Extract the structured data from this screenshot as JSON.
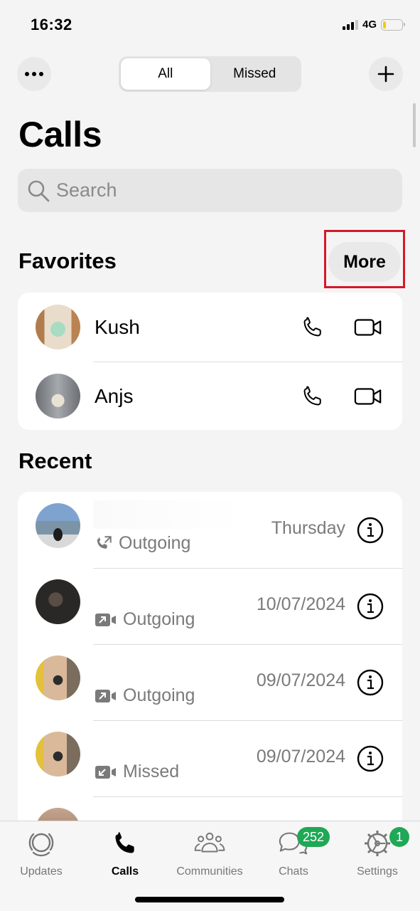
{
  "status_bar": {
    "time": "16:32",
    "network": "4G",
    "battery_level": 0.1
  },
  "header": {
    "menu_icon": "ellipsis-icon",
    "add_icon": "plus-icon",
    "segments": [
      {
        "label": "All",
        "active": true
      },
      {
        "label": "Missed",
        "active": false
      }
    ]
  },
  "page_title": "Calls",
  "search": {
    "placeholder": "Search",
    "value": ""
  },
  "favorites": {
    "title": "Favorites",
    "more_label": "More",
    "items": [
      {
        "name": "Kush",
        "call_icon": "phone-icon",
        "video_icon": "video-icon"
      },
      {
        "name": "Anjs",
        "call_icon": "phone-icon",
        "video_icon": "video-icon"
      }
    ]
  },
  "recent": {
    "title": "Recent",
    "items": [
      {
        "name": "",
        "call_type": "Outgoing",
        "call_kind": "voice",
        "direction": "outgoing",
        "date": "Thursday"
      },
      {
        "name": "",
        "call_type": "Outgoing",
        "call_kind": "video",
        "direction": "outgoing",
        "date": "10/07/2024"
      },
      {
        "name": "",
        "call_type": "Outgoing",
        "call_kind": "video",
        "direction": "outgoing",
        "date": "09/07/2024"
      },
      {
        "name": "",
        "call_type": "Missed",
        "call_kind": "video",
        "direction": "incoming",
        "date": "09/07/2024"
      }
    ]
  },
  "tab_bar": {
    "tabs": [
      {
        "label": "Updates",
        "icon": "updates-icon",
        "active": false
      },
      {
        "label": "Calls",
        "icon": "phone-icon",
        "active": true
      },
      {
        "label": "Communities",
        "icon": "communities-icon",
        "active": false
      },
      {
        "label": "Chats",
        "icon": "chats-icon",
        "active": false,
        "badge": "252"
      },
      {
        "label": "Settings",
        "icon": "settings-icon",
        "active": false,
        "badge": "1"
      }
    ]
  },
  "colors": {
    "accent_badge": "#1fa855",
    "highlight_box": "#d4182a",
    "secondary_text": "#7a7a7a"
  }
}
